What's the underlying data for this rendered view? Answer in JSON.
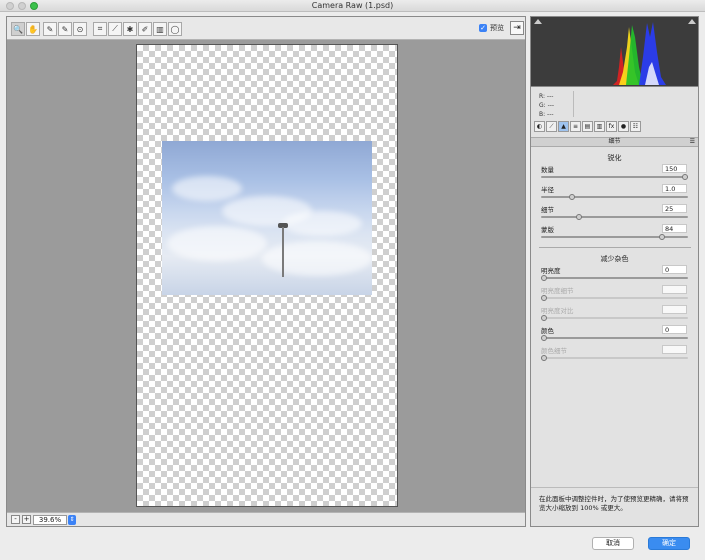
{
  "window": {
    "title": "Camera Raw (1.psd)"
  },
  "toolbar": {
    "tools": [
      "zoom-icon",
      "hand-icon",
      "white-balance-icon",
      "color-sampler-icon",
      "target-adjust-icon",
      "crop-icon",
      "straighten-icon",
      "spot-removal-icon",
      "red-eye-icon",
      "adjustment-brush-icon",
      "graduated-filter-icon"
    ],
    "preview_label": "预览",
    "preview_checked": true
  },
  "statusbar": {
    "zoom_value": "39.6%",
    "zoom_out": "-",
    "zoom_in": "+"
  },
  "readout": {
    "r": "R:  ---",
    "g": "G:  ---",
    "b": "B:  ---"
  },
  "panel": {
    "title": "细节",
    "sharpen": {
      "title": "锐化",
      "sliders": [
        {
          "label": "数量",
          "value": "150",
          "fraction": 1.0
        },
        {
          "label": "半径",
          "value": "1.0",
          "fraction": 0.2
        },
        {
          "label": "细节",
          "value": "25",
          "fraction": 0.25
        },
        {
          "label": "蒙版",
          "value": "84",
          "fraction": 0.84
        }
      ]
    },
    "noise": {
      "title": "减少杂色",
      "sliders": [
        {
          "label": "明亮度",
          "value": "0",
          "fraction": 0,
          "dim": false
        },
        {
          "label": "明亮度细节",
          "value": "",
          "fraction": 0,
          "dim": true
        },
        {
          "label": "明亮度对比",
          "value": "",
          "fraction": 0,
          "dim": true
        },
        {
          "label": "颜色",
          "value": "0",
          "fraction": 0,
          "dim": false
        },
        {
          "label": "颜色细节",
          "value": "",
          "fraction": 0,
          "dim": true
        }
      ]
    },
    "note": "在此面板中调整控件时，为了使预览更精确，请将预览大小缩放到 100% 或更大。"
  },
  "buttons": {
    "cancel": "取消",
    "ok": "确定"
  },
  "colors": {
    "accent": "#3a8cf0",
    "histogram_bg": "#3c3c3c"
  }
}
